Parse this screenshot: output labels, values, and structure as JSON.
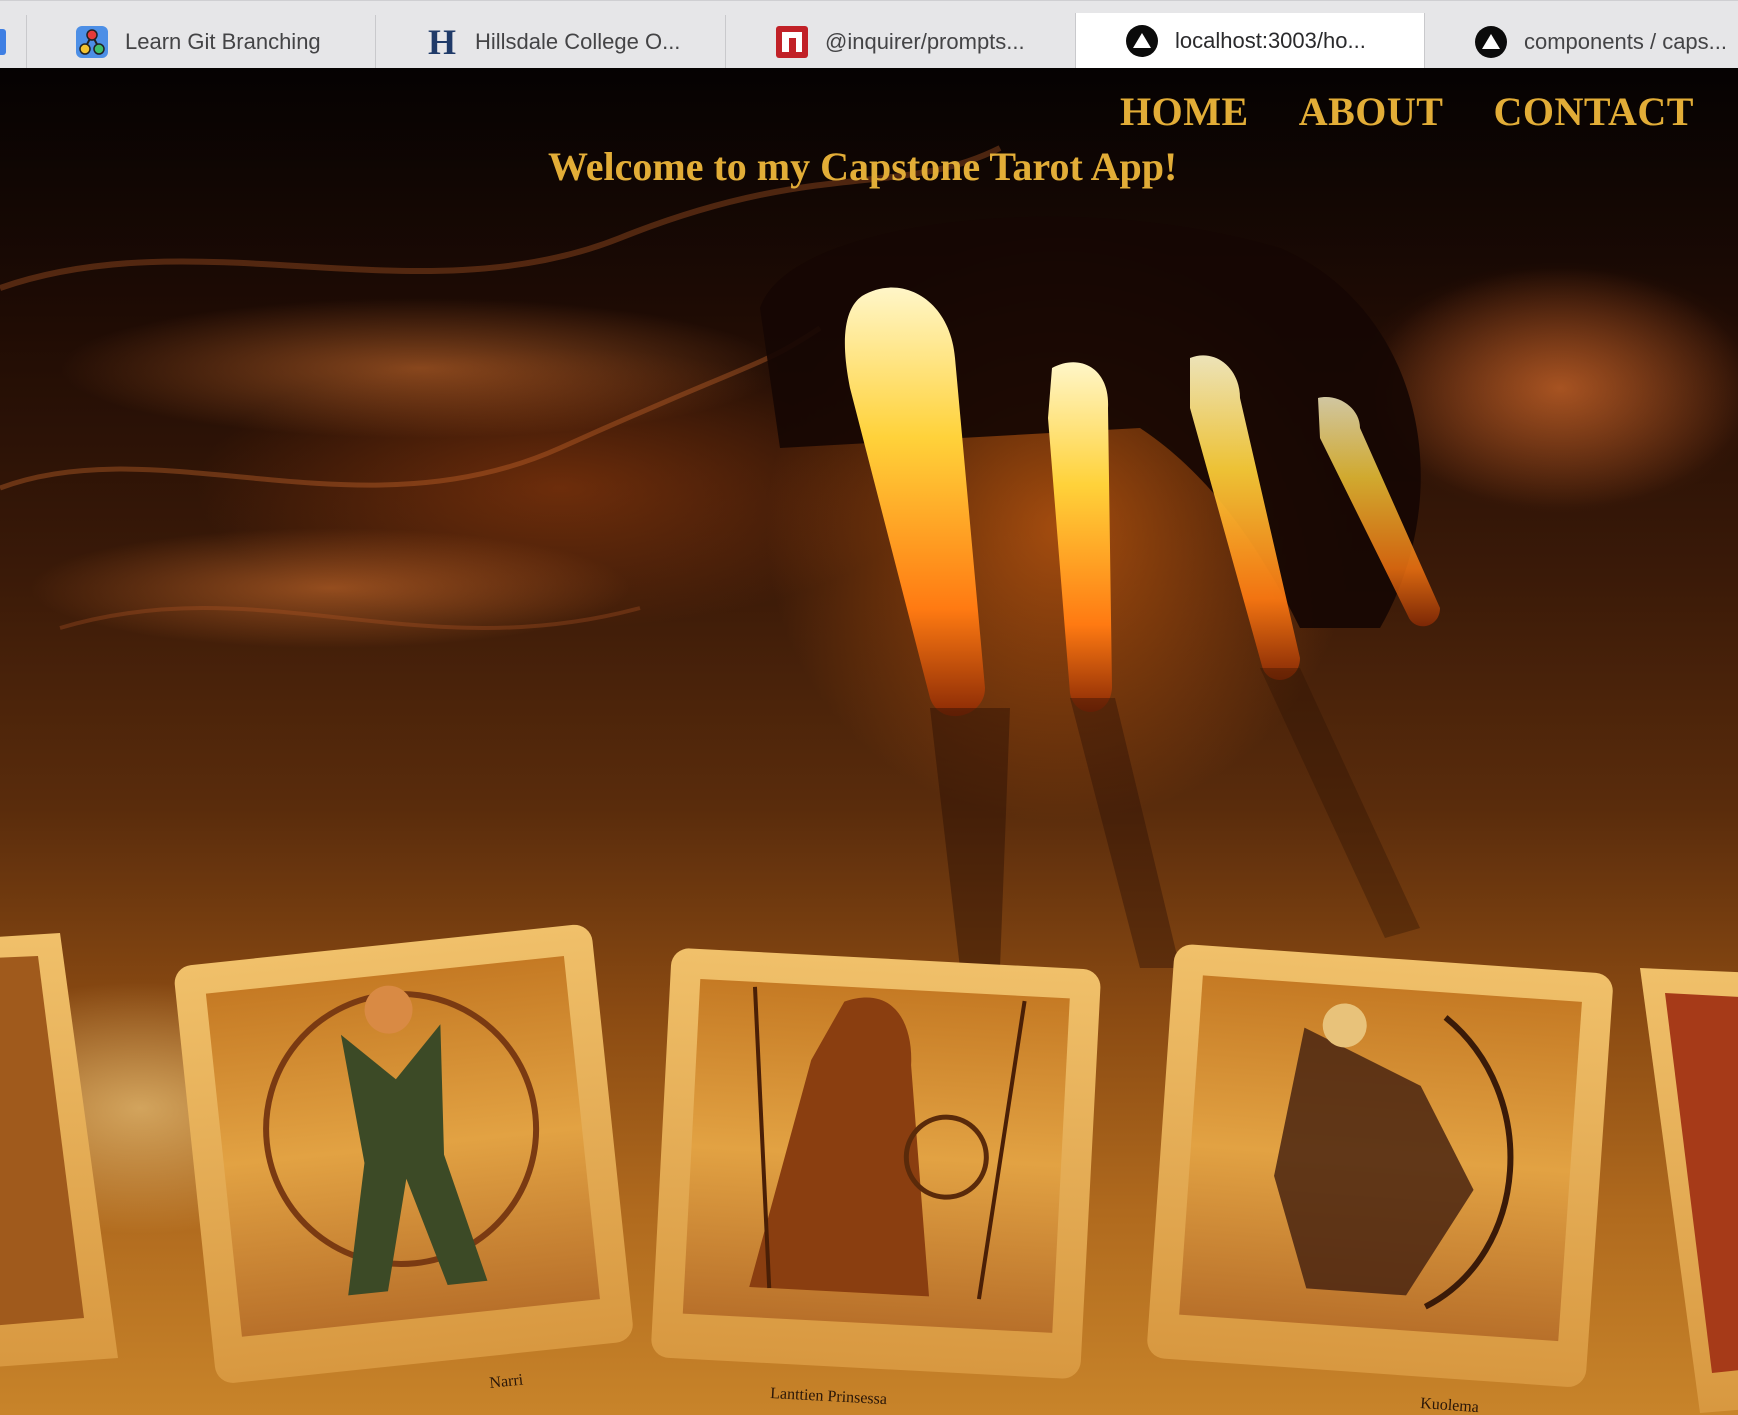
{
  "browser": {
    "tabs": [
      {
        "label": "Learn Git Branching",
        "icon": "git-branch-icon"
      },
      {
        "label": "Hillsdale College O...",
        "icon": "hillsdale-h-icon"
      },
      {
        "label": "@inquirer/prompts...",
        "icon": "npm-icon"
      },
      {
        "label": "localhost:3003/ho...",
        "icon": "triangle-icon",
        "active": true
      },
      {
        "label": "components / caps...",
        "icon": "triangle-icon"
      }
    ]
  },
  "nav": {
    "home": "HOME",
    "about": "ABOUT",
    "contact": "CONTACT"
  },
  "hero": {
    "welcome": "Welcome to my Capstone Tarot App!",
    "cards": [
      {
        "caption": "Narri"
      },
      {
        "caption": "Lanttien Prinsessa"
      },
      {
        "caption": "Kuolema"
      }
    ]
  },
  "colors": {
    "accent": "#e2ad37",
    "tab_active": "#ffffff",
    "tab_bar": "#e6e6e8"
  }
}
